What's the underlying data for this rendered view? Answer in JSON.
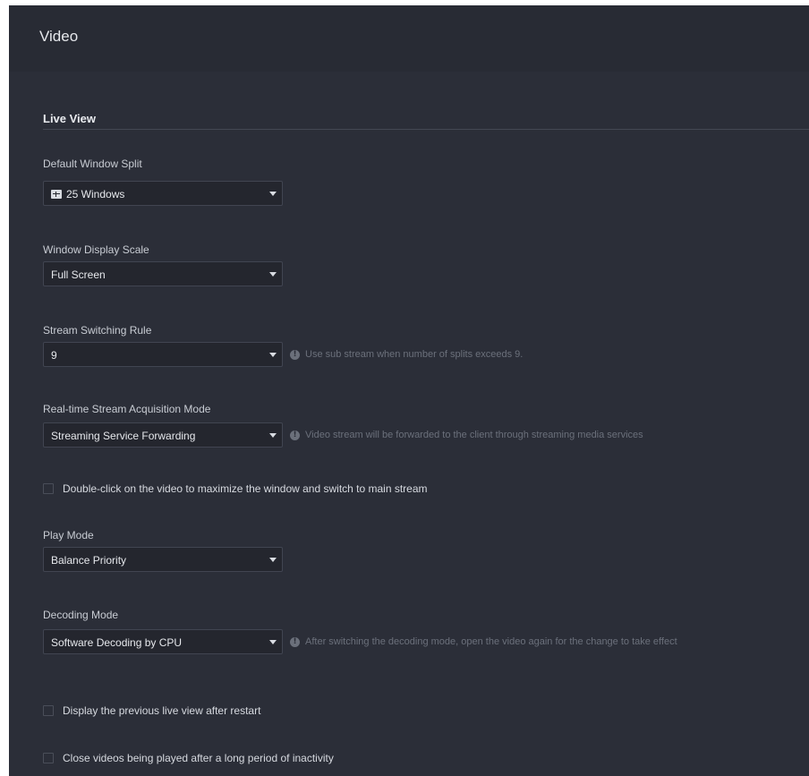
{
  "page": {
    "title": "Video"
  },
  "section": {
    "title": "Live View"
  },
  "fields": {
    "window_split": {
      "label": "Default Window Split",
      "value": "25 Windows",
      "icon": "grid-split-icon"
    },
    "display_scale": {
      "label": "Window Display Scale",
      "value": "Full Screen"
    },
    "stream_switching": {
      "label": "Stream Switching Rule",
      "value": "9",
      "hint": "Use sub stream when number of splits exceeds 9."
    },
    "acquisition_mode": {
      "label": "Real-time Stream Acquisition Mode",
      "value": "Streaming Service Forwarding",
      "hint": "Video stream will be forwarded to the client through streaming media services"
    },
    "double_click": {
      "label": "Double-click on the video to maximize the window and switch to main stream",
      "checked": false
    },
    "play_mode": {
      "label": "Play Mode",
      "value": "Balance Priority"
    },
    "decoding_mode": {
      "label": "Decoding Mode",
      "value": "Software Decoding by CPU",
      "hint": "After switching the decoding mode, open the video again for the change to take effect"
    },
    "restore_view": {
      "label": "Display the previous live view after restart",
      "checked": false
    },
    "close_inactive": {
      "label": "Close videos being played after a long period of inactivity",
      "checked": false
    }
  },
  "colors": {
    "background": "#2b2e38",
    "header": "#282b34",
    "input_bg": "#24262e",
    "hint": "#6b707b"
  }
}
